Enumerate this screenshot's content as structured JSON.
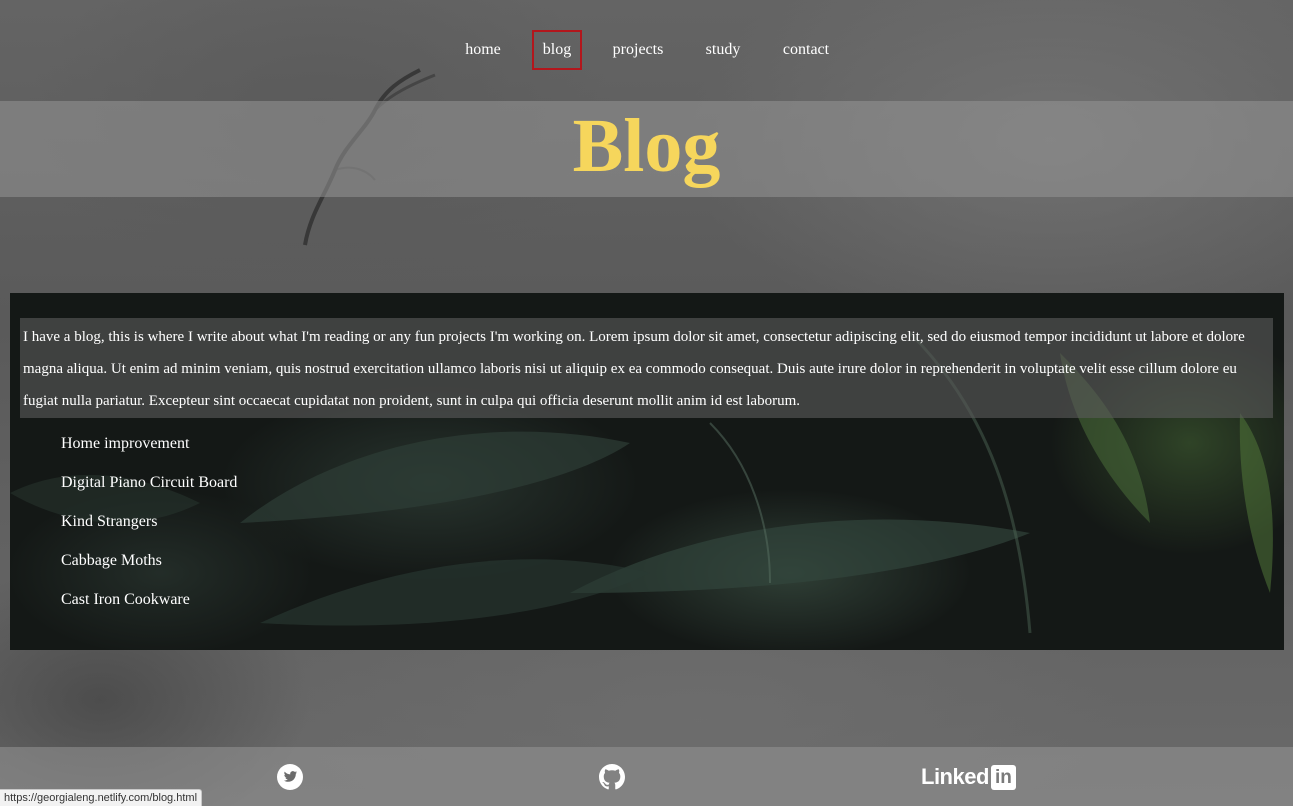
{
  "nav": {
    "items": [
      {
        "label": "home",
        "active": false
      },
      {
        "label": "blog",
        "active": true
      },
      {
        "label": "projects",
        "active": false
      },
      {
        "label": "study",
        "active": false
      },
      {
        "label": "contact",
        "active": false
      }
    ],
    "active_border_color": "#b3161c"
  },
  "header": {
    "title": "Blog",
    "title_color": "#f6d65c"
  },
  "main": {
    "intro": "I have a blog, this is where I write about what I'm reading or any fun projects I'm working on. Lorem ipsum dolor sit amet, consectetur adipiscing elit, sed do eiusmod tempor incididunt ut labore et dolore magna aliqua. Ut enim ad minim veniam, quis nostrud exercitation ullamco laboris nisi ut aliquip ex ea commodo consequat. Duis aute irure dolor in reprehenderit in voluptate velit esse cillum dolore eu fugiat nulla pariatur. Excepteur sint occaecat cupidatat non proident, sunt in culpa qui officia deserunt mollit anim id est laborum.",
    "posts": [
      {
        "label": "Home improvement"
      },
      {
        "label": "Digital Piano Circuit Board"
      },
      {
        "label": "Kind Strangers"
      },
      {
        "label": "Cabbage Moths"
      },
      {
        "label": "Cast Iron Cookware"
      }
    ]
  },
  "footer": {
    "icons": [
      "twitter-icon",
      "github-icon",
      "linkedin-icon"
    ],
    "linkedin_word": "Linked",
    "linkedin_box": "in"
  },
  "status_bar": {
    "url": "https://georgialeng.netlify.com/blog.html"
  }
}
